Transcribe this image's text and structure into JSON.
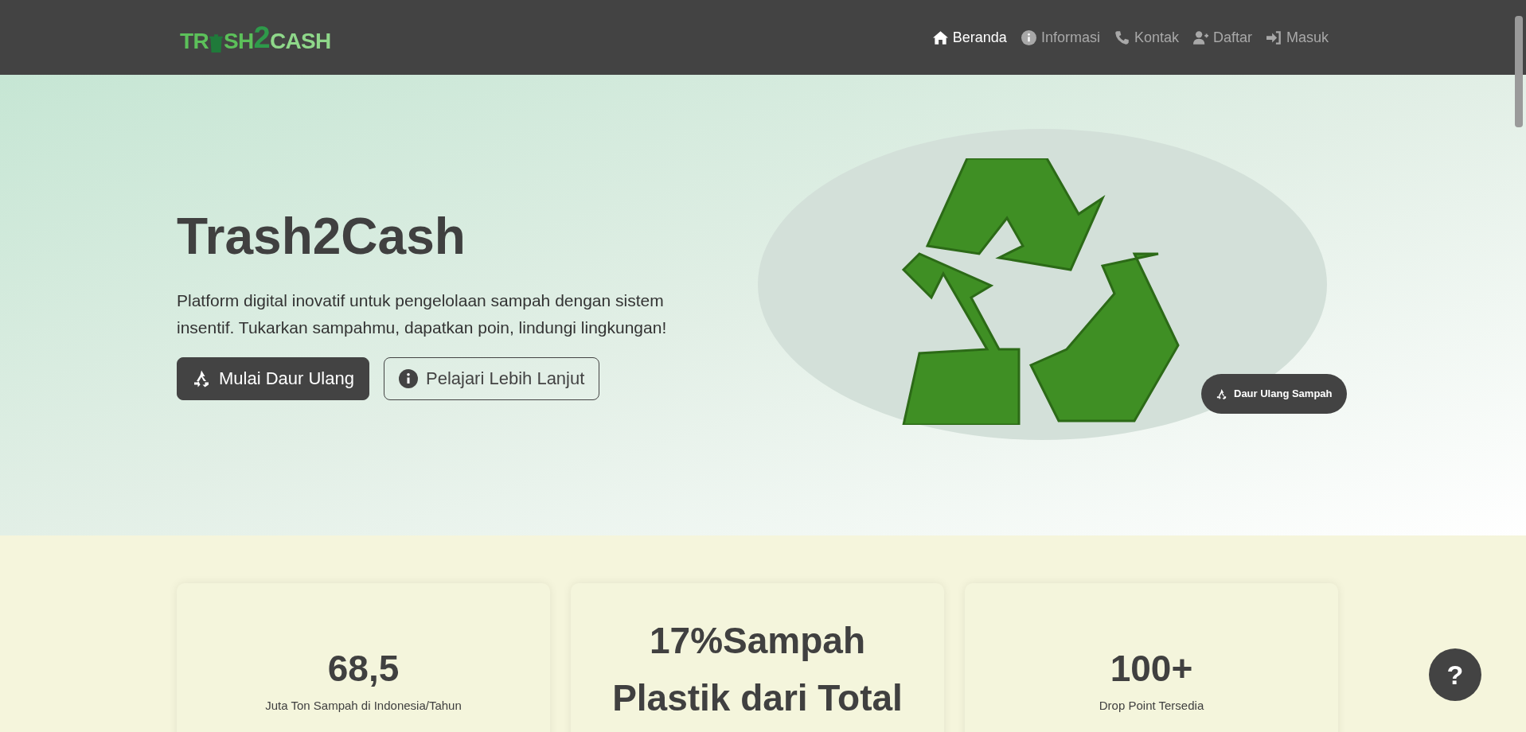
{
  "navbar": {
    "logo": {
      "before": "TR",
      "after": "SH",
      "two": "2",
      "cash": "CASH"
    },
    "links": [
      {
        "label": "Beranda",
        "kind": "home",
        "selected": true
      },
      {
        "label": "Informasi",
        "kind": "info",
        "selected": false
      },
      {
        "label": "Kontak",
        "kind": "phone",
        "selected": false
      },
      {
        "label": "Daftar",
        "kind": "signup",
        "selected": false
      },
      {
        "label": "Masuk",
        "kind": "login",
        "selected": false
      }
    ]
  },
  "hero": {
    "title": "Trash2Cash",
    "description": "Platform digital inovatif untuk pengelolaan sampah dengan sistem insentif. Tukarkan sampahmu, dapatkan poin, lindungi lingkungan!",
    "buttons": [
      {
        "label": "Mulai Daur Ulang",
        "kind": "primary"
      },
      {
        "label": "Pelajari Lebih Lanjut",
        "kind": "outline"
      }
    ],
    "badge": "Daur Ulang Sampah"
  },
  "stats": [
    {
      "value": "68,5",
      "caption": "Juta Ton Sampah di Indonesia/Tahun"
    },
    {
      "value": "17%Sampah Plastik dari Total"
    },
    {
      "value": "100+",
      "caption": "Drop Point Tersedia"
    }
  ],
  "help_button": "?"
}
